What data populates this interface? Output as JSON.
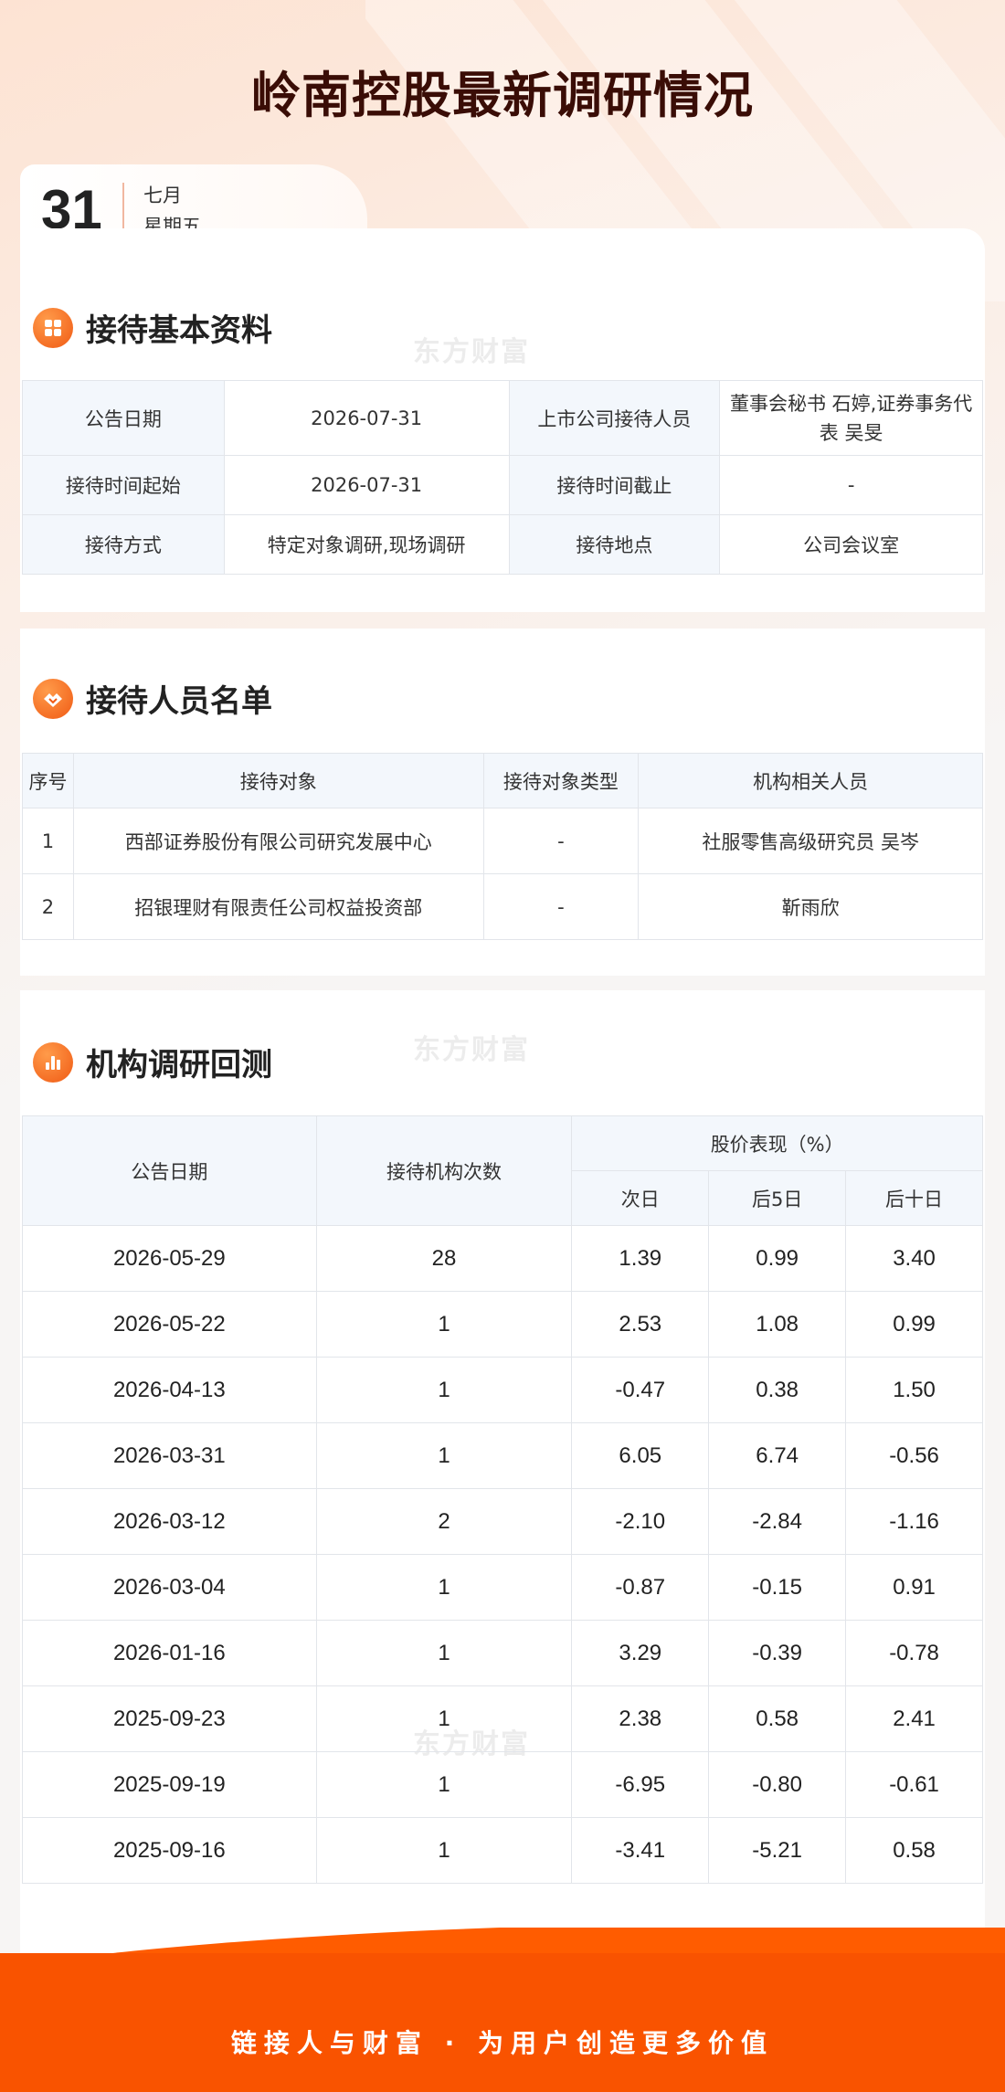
{
  "header": {
    "title": "岭南控股最新调研情况",
    "day": "31",
    "month": "七月",
    "weekday": "星期五"
  },
  "watermark": "东方财富",
  "basic_info": {
    "section_title": "接待基本资料",
    "rows": [
      [
        {
          "label": "公告日期"
        },
        {
          "value": "2026-07-31"
        },
        {
          "label": "上市公司接待人员"
        },
        {
          "value": "董事会秘书 石婷,证券事务代表 吴旻"
        }
      ],
      [
        {
          "label": "接待时间起始"
        },
        {
          "value": "2026-07-31"
        },
        {
          "label": "接待时间截止"
        },
        {
          "value": "-"
        }
      ],
      [
        {
          "label": "接待方式"
        },
        {
          "value": "特定对象调研,现场调研"
        },
        {
          "label": "接待地点"
        },
        {
          "value": "公司会议室"
        }
      ]
    ]
  },
  "visitors": {
    "section_title": "接待人员名单",
    "headers": [
      "序号",
      "接待对象",
      "接待对象类型",
      "机构相关人员"
    ],
    "rows": [
      [
        "1",
        "西部证券股份有限公司研究发展中心",
        "-",
        "社服零售高级研究员 吴岑"
      ],
      [
        "2",
        "招银理财有限责任公司权益投资部",
        "-",
        "靳雨欣"
      ]
    ]
  },
  "backtest": {
    "section_title": "机构调研回测",
    "headers": {
      "date": "公告日期",
      "count": "接待机构次数",
      "perf": "股价表现（%）",
      "d1": "次日",
      "d5": "后5日",
      "d10": "后十日"
    },
    "rows": [
      [
        "2026-05-29",
        "28",
        "1.39",
        "0.99",
        "3.40"
      ],
      [
        "2026-05-22",
        "1",
        "2.53",
        "1.08",
        "0.99"
      ],
      [
        "2026-04-13",
        "1",
        "-0.47",
        "0.38",
        "1.50"
      ],
      [
        "2026-03-31",
        "1",
        "6.05",
        "6.74",
        "-0.56"
      ],
      [
        "2026-03-12",
        "2",
        "-2.10",
        "-2.84",
        "-1.16"
      ],
      [
        "2026-03-04",
        "1",
        "-0.87",
        "-0.15",
        "0.91"
      ],
      [
        "2026-01-16",
        "1",
        "3.29",
        "-0.39",
        "-0.78"
      ],
      [
        "2025-09-23",
        "1",
        "2.38",
        "0.58",
        "2.41"
      ],
      [
        "2025-09-19",
        "1",
        "-6.95",
        "-0.80",
        "-0.61"
      ],
      [
        "2025-09-16",
        "1",
        "-3.41",
        "-5.21",
        "0.58"
      ]
    ]
  },
  "footer": {
    "slogan": "链接人与财富 · 为用户创造更多价值"
  },
  "colors": {
    "accent": "#f05a14",
    "title": "#3a0d06",
    "footer": "#ff5c00"
  }
}
